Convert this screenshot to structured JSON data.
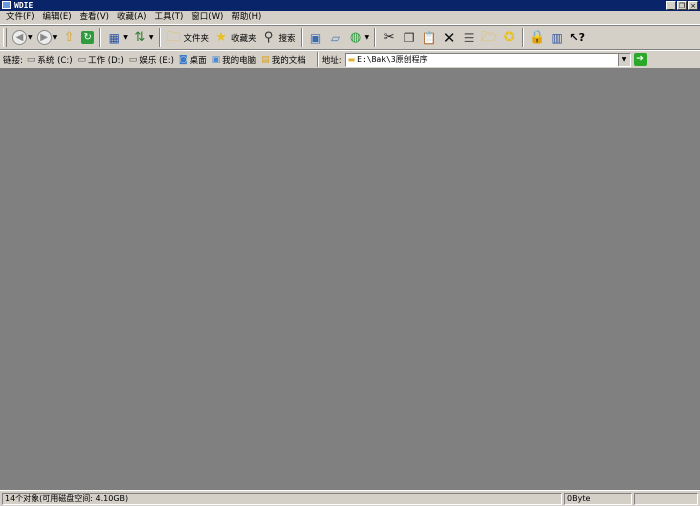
{
  "window": {
    "title": "WDIE",
    "min_glyph": "_",
    "restore_glyph": "❐",
    "close_glyph": "×"
  },
  "menu": [
    {
      "label": "文件(F)"
    },
    {
      "label": "编辑(E)"
    },
    {
      "label": "查看(V)"
    },
    {
      "label": "收藏(A)"
    },
    {
      "label": "工具(T)"
    },
    {
      "label": "窗口(W)"
    },
    {
      "label": "帮助(H)"
    }
  ],
  "toolbar": {
    "folder_label": "文件夹",
    "favorites_label": "收藏夹",
    "search_label": "搜索"
  },
  "links": {
    "label": "链接:",
    "items": [
      {
        "label": "系统 (C:)",
        "icon": "drive-icon"
      },
      {
        "label": "工作 (D:)",
        "icon": "drive-icon"
      },
      {
        "label": "娱乐 (E:)",
        "icon": "drive-icon"
      },
      {
        "label": "桌面",
        "icon": "desktop-icon"
      },
      {
        "label": "我的电脑",
        "icon": "computer-icon"
      },
      {
        "label": "我的文档",
        "icon": "documents-icon"
      }
    ]
  },
  "address": {
    "label": "地址:",
    "value": "E:\\Bak\\3原创程序"
  },
  "status": {
    "objects": "14个对象(可用磁盘空间: 4.10GB)",
    "size": "0Byte",
    "extra": ""
  },
  "colors": {
    "title_bar": "#0a246a",
    "chrome": "#d4d0c8",
    "content_bg": "#808080"
  }
}
